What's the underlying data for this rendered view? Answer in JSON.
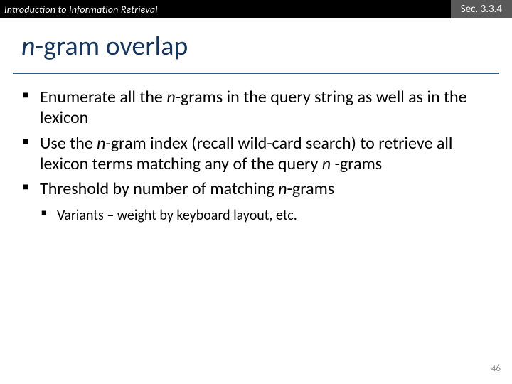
{
  "header": {
    "left": "Introduction to Information Retrieval",
    "right": "Sec. 3.3.4"
  },
  "title": {
    "n": "n",
    "rest": "-gram overlap"
  },
  "bullets": {
    "b1a": "Enumerate all the ",
    "b1n": "n",
    "b1b": "-grams in the query string as well as in the lexicon",
    "b2a": "Use the ",
    "b2n": "n",
    "b2b": "-gram index (recall wild-card search) to retrieve all lexicon terms matching any of the query ",
    "b2n2": "n",
    "b2c": " -grams",
    "b3a": "Threshold by number of matching ",
    "b3n": "n",
    "b3b": "-grams",
    "s1": "Variants – weight by keyboard layout, etc."
  },
  "pagenum": "46"
}
